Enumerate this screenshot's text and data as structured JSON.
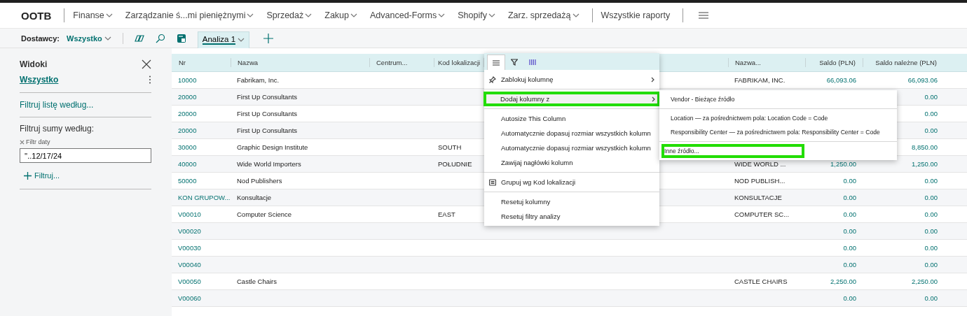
{
  "nav": {
    "app": "OOTB",
    "items": [
      {
        "label": "Finanse"
      },
      {
        "label": "Zarządzanie ś...mi pieniężnymi"
      },
      {
        "label": "Sprzedaż"
      },
      {
        "label": "Zakup"
      },
      {
        "label": "Advanced-Forms"
      },
      {
        "label": "Shopify"
      },
      {
        "label": "Zarz. sprzedażą"
      }
    ],
    "reports": "Wszystkie raporty"
  },
  "toolbar": {
    "label": "Dostawcy:",
    "view": "Wszystko",
    "tabs": [
      {
        "label": "Analiza 1",
        "selected": true
      }
    ]
  },
  "sidebar": {
    "title": "Widoki",
    "view": "Wszystko",
    "filter_list": "Filtruj listę według...",
    "filter_totals": "Filtruj sumy według:",
    "date_filter": {
      "label": "Filtr daty",
      "value": "''..12/17/24"
    },
    "add_filter": "Filtruj..."
  },
  "table": {
    "columns": [
      {
        "label": "Nr"
      },
      {
        "label": "Nazwa"
      },
      {
        "label": "Centrum..."
      },
      {
        "label": "Kod lokalizacji"
      },
      {
        "label": "Nazwa..."
      },
      {
        "label": "Saldo (PLN)"
      },
      {
        "label": "Saldo należne (PLN)"
      }
    ],
    "rows": [
      {
        "cells": [
          "10000",
          "Fabrikam, Inc.",
          null,
          null,
          "FABRIKAM, INC.",
          "66,093.06",
          "66,093.06"
        ]
      },
      {
        "cells": [
          "20000",
          "First Up Consultants",
          null,
          null,
          null,
          null,
          "0.00"
        ]
      },
      {
        "cells": [
          "20000",
          "First Up Consultants",
          null,
          null,
          null,
          null,
          "0.00"
        ]
      },
      {
        "cells": [
          "20000",
          "First Up Consultants",
          null,
          null,
          null,
          null,
          "0.00"
        ]
      },
      {
        "cells": [
          "30000",
          "Graphic Design Institute",
          null,
          "SOUTH",
          null,
          null,
          "8,850.00"
        ]
      },
      {
        "cells": [
          "40000",
          "Wide World Importers",
          null,
          "POŁUDNIE",
          "WIDE WORLD ...",
          "1,250.00",
          "1,250.00"
        ]
      },
      {
        "cells": [
          "50000",
          "Nod Publishers",
          null,
          null,
          "NOD PUBLISH...",
          "0.00",
          "0.00"
        ]
      },
      {
        "cells": [
          "KON GRUPOW...",
          "Konsultacje",
          null,
          null,
          "KONSULTACJE",
          "0.00",
          "0.00"
        ]
      },
      {
        "cells": [
          "V00010",
          "Computer Science",
          null,
          "EAST",
          "COMPUTER SC...",
          "0.00",
          "0.00"
        ]
      },
      {
        "cells": [
          "V00020",
          null,
          null,
          null,
          null,
          "0.00",
          "0.00"
        ]
      },
      {
        "cells": [
          "V00030",
          null,
          null,
          null,
          null,
          "0.00",
          "0.00"
        ]
      },
      {
        "cells": [
          "V00040",
          null,
          null,
          null,
          null,
          "0.00",
          "0.00"
        ]
      },
      {
        "cells": [
          "V00050",
          "Castle Chairs",
          null,
          null,
          "CASTLE CHAIRS",
          "2,250.00",
          "2,250.00"
        ]
      },
      {
        "cells": [
          "V00060",
          null,
          null,
          null,
          null,
          "0.00",
          "0.00"
        ]
      }
    ]
  },
  "column_menu": {
    "tabs": [
      {
        "kind": "menu",
        "selected": true
      },
      {
        "kind": "filter",
        "selected": false
      },
      {
        "kind": "columns",
        "selected": false
      }
    ],
    "groups": [
      [
        {
          "label": "Zablokuj kolumnę",
          "kind": "pin",
          "submenu": true,
          "highlighted": false
        }
      ],
      [
        {
          "label": "Dodaj kolumny z",
          "submenu": true,
          "highlighted": true
        }
      ],
      [
        {
          "label": "Autosize This Column",
          "submenu": false,
          "highlighted": false
        },
        {
          "label": "Automatycznie dopasuj rozmiar wszystkich kolumn",
          "submenu": false,
          "highlighted": false
        },
        {
          "label": "Automatycznie dopasuj rozmiar wszystkich kolumn",
          "submenu": false,
          "highlighted": false
        },
        {
          "label": "Zawijaj nagłówki kolumn",
          "submenu": false,
          "highlighted": false
        }
      ],
      [
        {
          "label": "Grupuj wg Kod lokalizacji",
          "kind": "group",
          "submenu": false,
          "highlighted": false
        }
      ],
      [
        {
          "label": "Resetuj kolumny",
          "submenu": false,
          "highlighted": false
        },
        {
          "label": "Resetuj filtry analizy",
          "submenu": false,
          "highlighted": false
        }
      ]
    ]
  },
  "submenu": {
    "groups": [
      [
        {
          "label": "Vendor - Bieżące źródło",
          "highlighted": false
        }
      ],
      [
        {
          "label": "Location — za pośrednictwem pola: Location Code = Code",
          "highlighted": false
        },
        {
          "label": "Responsibility Center — za pośrednictwem pola: Responsibility Center = Code",
          "highlighted": false
        }
      ],
      [
        {
          "label": "Inne źródło...",
          "highlighted": true
        }
      ]
    ]
  }
}
